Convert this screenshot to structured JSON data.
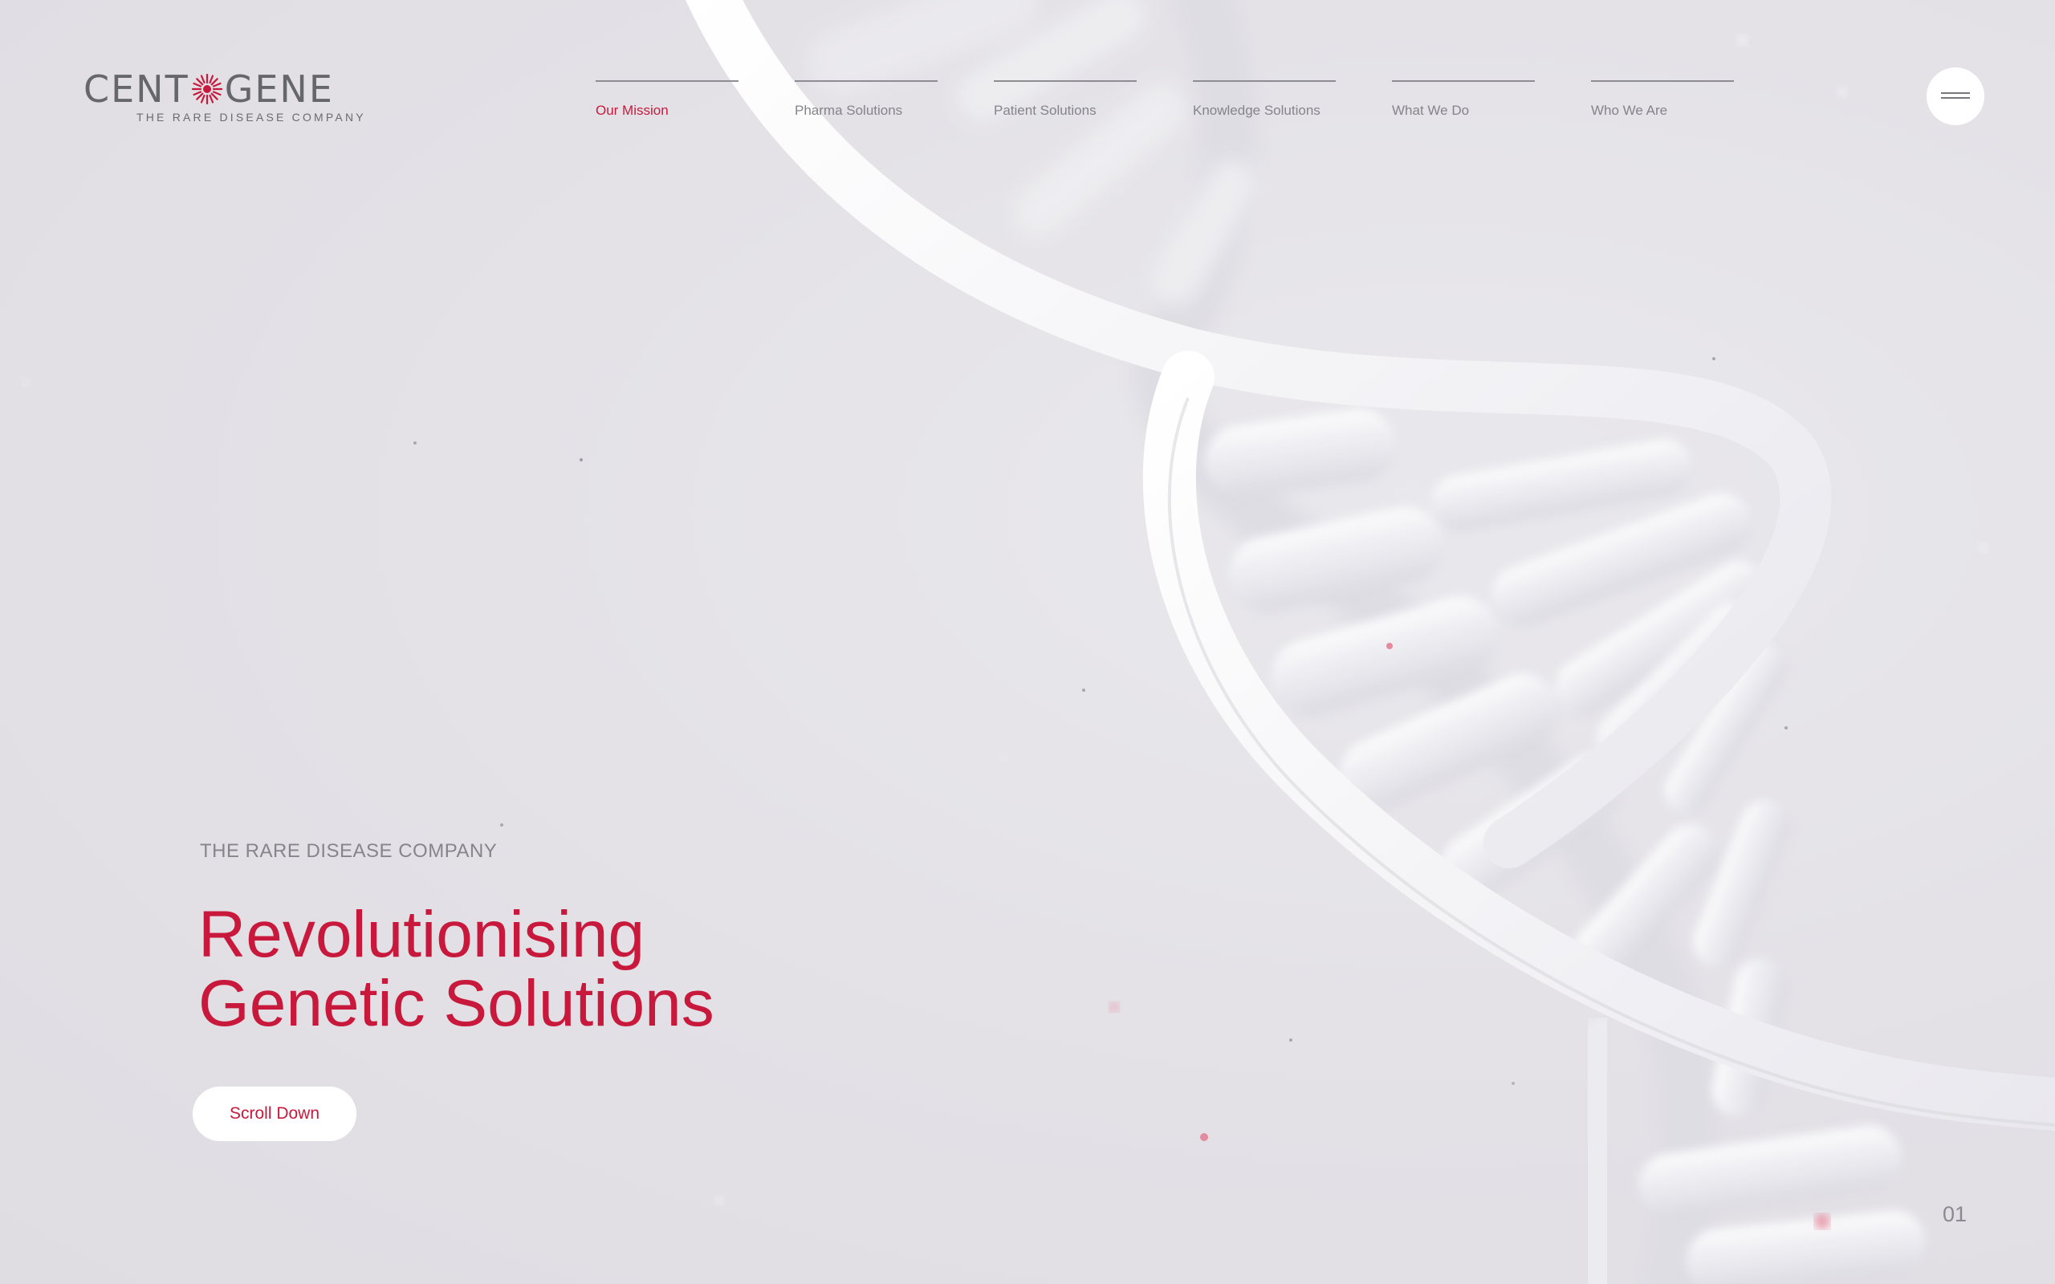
{
  "brand": {
    "name_left": "CENT",
    "name_right": "GENE",
    "tagline": "THE RARE DISEASE COMPANY",
    "accent_color": "#c8193c"
  },
  "nav": {
    "items": [
      {
        "label": "Our Mission",
        "active": true
      },
      {
        "label": "Pharma Solutions",
        "active": false
      },
      {
        "label": "Patient Solutions",
        "active": false
      },
      {
        "label": "Knowledge Solutions",
        "active": false
      },
      {
        "label": "What We Do",
        "active": false
      },
      {
        "label": "Who We Are",
        "active": false
      }
    ],
    "menu_icon": "hamburger-icon"
  },
  "hero": {
    "eyebrow": "THE RARE DISEASE COMPANY",
    "headline_line1": "Revolutionising",
    "headline_line2": "Genetic Solutions",
    "cta_label": "Scroll Down"
  },
  "pagination": {
    "current": "01"
  }
}
